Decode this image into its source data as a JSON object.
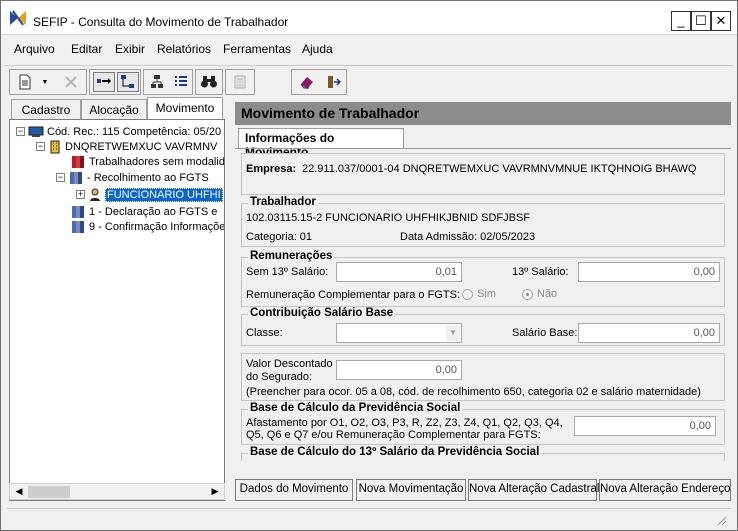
{
  "window": {
    "title": "SEFIP - Consulta do Movimento de Trabalhador",
    "minimize": "_",
    "maximize": "☐",
    "close": "✕"
  },
  "menu": [
    "Arquivo",
    "Editar",
    "Exibir",
    "Relatórios",
    "Ferramentas",
    "Ajuda"
  ],
  "left_tabs": [
    "Cadastro",
    "Alocação",
    "Movimento"
  ],
  "tree": [
    {
      "text": "Cód. Rec.: 115 Competência: 05/20",
      "icon": "computer-icon"
    },
    {
      "text": "DNQRETWEMXUC VAVRMNV",
      "icon": "building-icon"
    },
    {
      "text": "Trabalhadores sem modalid",
      "icon": "books-red-icon"
    },
    {
      "text": "- Recolhimento ao FGTS",
      "icon": "books-blue-icon"
    },
    {
      "text": "FUNCIONARIO UHFHI",
      "icon": "person-icon"
    },
    {
      "text": "1 - Declaração ao FGTS e",
      "icon": "books-blue-icon"
    },
    {
      "text": "9 - Confirmação Informaçõe",
      "icon": "books-blue-icon"
    }
  ],
  "panel": {
    "header": "Movimento de Trabalhador",
    "tab": "Informações do Movimento",
    "empresa_label": "Empresa:",
    "empresa_value": "22.911.037/0001-04  DNQRETWEMXUC VAVRMNVMNUE IKTQHNOIG BHAWQ",
    "trabalhador": {
      "title": "Trabalhador",
      "id": "102.03115.15-2  FUNCIONARIO UHFHIKJBNID SDFJBSF",
      "categoria_label": "Categoria: 01",
      "admissao_label": "Data Admissão: 02/05/2023"
    },
    "remuneracoes": {
      "title": "Remunerações",
      "sem13_label": "Sem 13º Salário:",
      "sem13_value": "0,01",
      "s13_label": "13º Salário:",
      "s13_value": "0,00",
      "compl_label": "Remuneração Complementar para o FGTS:",
      "sim": "Sim",
      "nao": "Não"
    },
    "contribuicao": {
      "title": "Contribuição Salário Base",
      "classe_label": "Classe:",
      "classe_value": "",
      "salario_label": "Salário Base:",
      "salario_value": "0,00"
    },
    "desconto": {
      "label1": "Valor Descontado",
      "label2": "do Segurado:",
      "value": "0,00",
      "note": "(Preencher para ocor. 05 a 08, cód. de recolhimento 650, categoria 02 e salário maternidade)"
    },
    "base_prev": {
      "title": "Base de Cálculo da Previdência Social",
      "text1": "Afastamento por O1, O2, O3, P3, R, Z2, Z3, Z4, Q1, Q2, Q3, Q4,",
      "text2": "Q5, Q6 e Q7  e/ou Remuneração Complementar para FGTS:",
      "value": "0,00"
    },
    "base13": {
      "title": "Base de Cálculo do 13º Salário da Previdência Social"
    }
  },
  "buttons": [
    "Dados do Movimento",
    "Nova Movimentação",
    "Nova Alteração Cadastral",
    "Nova Alteração Endereço"
  ]
}
